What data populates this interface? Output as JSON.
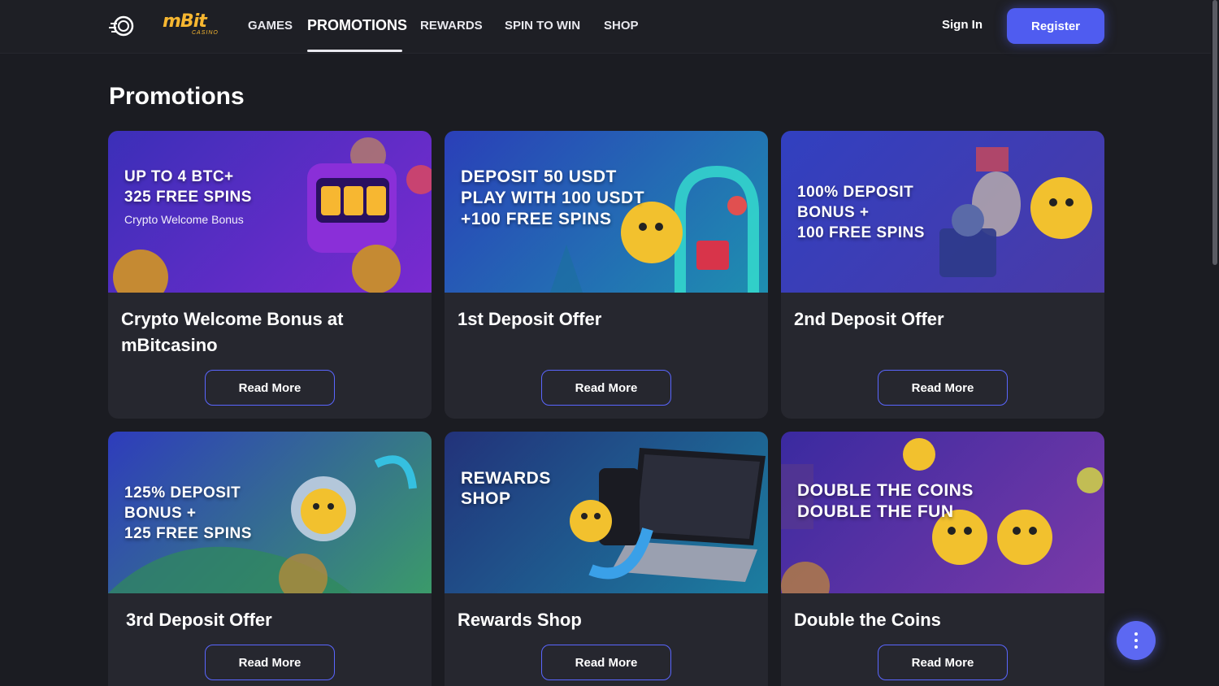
{
  "header": {
    "logo_text": "mBit",
    "logo_sub": "CASINO",
    "nav": [
      "GAMES",
      "PROMOTIONS",
      "REWARDS",
      "SPIN TO WIN",
      "SHOP"
    ],
    "active_nav": "PROMOTIONS",
    "signin_label": "Sign In",
    "register_label": "Register"
  },
  "page": {
    "title": "Promotions"
  },
  "read_more_label": "Read More",
  "cards": [
    {
      "title": "Crypto Welcome Bonus at mBitcasino",
      "banner_lines": [
        "UP TO 4 BTC+",
        "325 FREE SPINS"
      ],
      "banner_sub": "Crypto Welcome Bonus",
      "banner_colors": [
        "#3b2fb8",
        "#7a2ad0"
      ]
    },
    {
      "title": "1st Deposit Offer",
      "banner_lines": [
        "DEPOSIT 50 USDT",
        "PLAY WITH 100 USDT",
        "+100 FREE SPINS"
      ],
      "banner_sub": "",
      "banner_colors": [
        "#2a3fb8",
        "#1e8fb0"
      ]
    },
    {
      "title": "2nd Deposit Offer",
      "banner_lines": [
        "100% DEPOSIT",
        "BONUS +",
        "100 FREE SPINS"
      ],
      "banner_sub": "",
      "banner_colors": [
        "#3140c0",
        "#4a3aa8"
      ]
    },
    {
      "title": "3rd Deposit Offer",
      "banner_lines": [
        "125% DEPOSIT",
        "BONUS +",
        "125 FREE SPINS"
      ],
      "banner_sub": "",
      "banner_colors": [
        "#2e3cbc",
        "#3b9a6a"
      ]
    },
    {
      "title": "Rewards Shop",
      "banner_lines": [
        "REWARDS",
        "SHOP"
      ],
      "banner_sub": "",
      "banner_colors": [
        "#22327a",
        "#1c7ea0"
      ]
    },
    {
      "title": "Double the Coins",
      "banner_lines": [
        "DOUBLE THE COINS",
        "DOUBLE THE FUN"
      ],
      "banner_sub": "",
      "banner_colors": [
        "#3a2aa0",
        "#7a3aa8"
      ]
    }
  ]
}
